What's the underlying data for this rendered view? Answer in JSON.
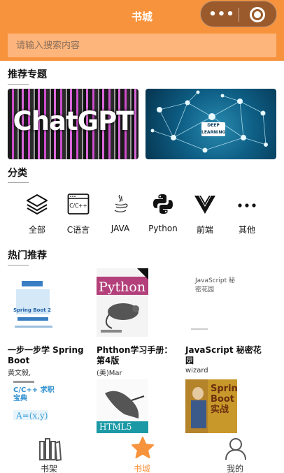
{
  "header": {
    "title": "书城",
    "more_icon": "more-dots-icon",
    "close_icon": "target-icon",
    "accent": "#f7933c"
  },
  "search": {
    "placeholder": "请输入搜索内容"
  },
  "sections": {
    "featured": "推荐专题",
    "category": "分类",
    "hot": "热门推荐"
  },
  "banners": [
    {
      "text": "ChatGPT"
    },
    {
      "text": "DEEP LEARNING"
    }
  ],
  "categories": [
    {
      "label": "全部",
      "icon": "layers-icon"
    },
    {
      "label": "C语言",
      "icon": "c-language-icon"
    },
    {
      "label": "JAVA",
      "icon": "java-icon"
    },
    {
      "label": "Python",
      "icon": "python-icon"
    },
    {
      "label": "前端",
      "icon": "vue-icon"
    },
    {
      "label": "其他",
      "icon": "more-icon"
    }
  ],
  "books": [
    {
      "title": "一步一步学 Spring Boot",
      "author": "黄文毅,",
      "cover_text": "Spring Boot 2"
    },
    {
      "title": "Phthon学习手册：第4版",
      "author": "(美)Mar",
      "cover_text": "Python"
    },
    {
      "title": "JavaScript 秘密花园",
      "author": "wizard",
      "cover_text": "JavaScript 秘密花园"
    },
    {
      "title": "",
      "author": "",
      "cover_text": "C/C++ 求职宝典"
    },
    {
      "title": "",
      "author": "",
      "cover_text": "HTML5"
    },
    {
      "title": "",
      "author": "",
      "cover_text": "Spring Boot 实战"
    }
  ],
  "tabs": [
    {
      "label": "书架",
      "icon": "bookshelf-icon"
    },
    {
      "label": "书城",
      "icon": "star-icon",
      "active": true
    },
    {
      "label": "我的",
      "icon": "user-icon"
    }
  ]
}
